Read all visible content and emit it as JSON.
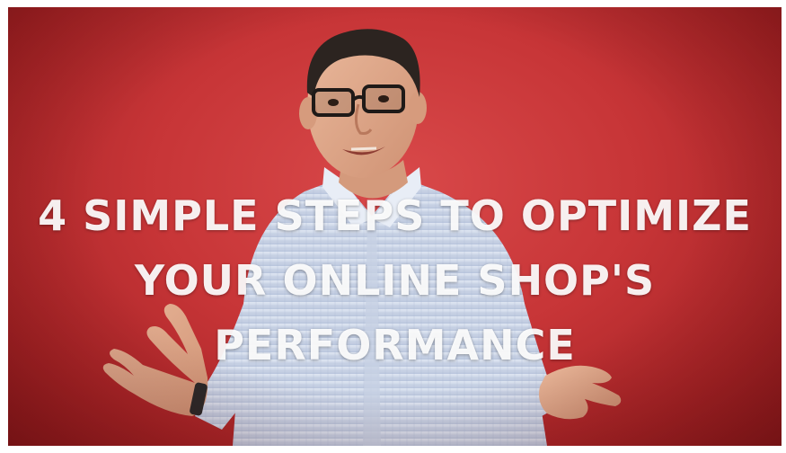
{
  "video": {
    "title_lines": [
      "4 SIMPLE STEPS TO OPTIMIZE",
      "YOUR ONLINE SHOP'S",
      "PERFORMANCE"
    ]
  },
  "colors": {
    "background": "#c73537",
    "title_text": "#ffffff",
    "shirt": "#c9d3e6",
    "skin": "#e2ad8f",
    "hair": "#2c2420"
  },
  "icons": {
    "presenter": "presenter-photo"
  }
}
